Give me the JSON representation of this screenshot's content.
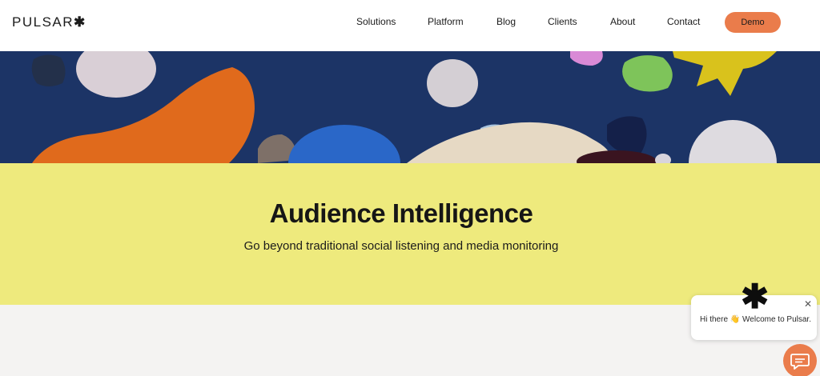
{
  "header": {
    "logo": "PULSAR",
    "logo_mark": "✱",
    "nav": [
      "Solutions",
      "Platform",
      "Blog",
      "Clients",
      "About",
      "Contact"
    ],
    "cta_label": "Demo"
  },
  "hero": {
    "title": "Audience Intelligence",
    "subtitle": "Go beyond traditional social listening and media monitoring"
  },
  "chat": {
    "logo_mark": "✱",
    "message": "Hi there 👋 Welcome to Pulsar.",
    "close_icon": "✕",
    "launcher_icon": "chat-icon"
  },
  "colors": {
    "accent": "#ea7c4b",
    "hero_bg": "#1c3466",
    "yellow_band": "#eeea7d"
  }
}
